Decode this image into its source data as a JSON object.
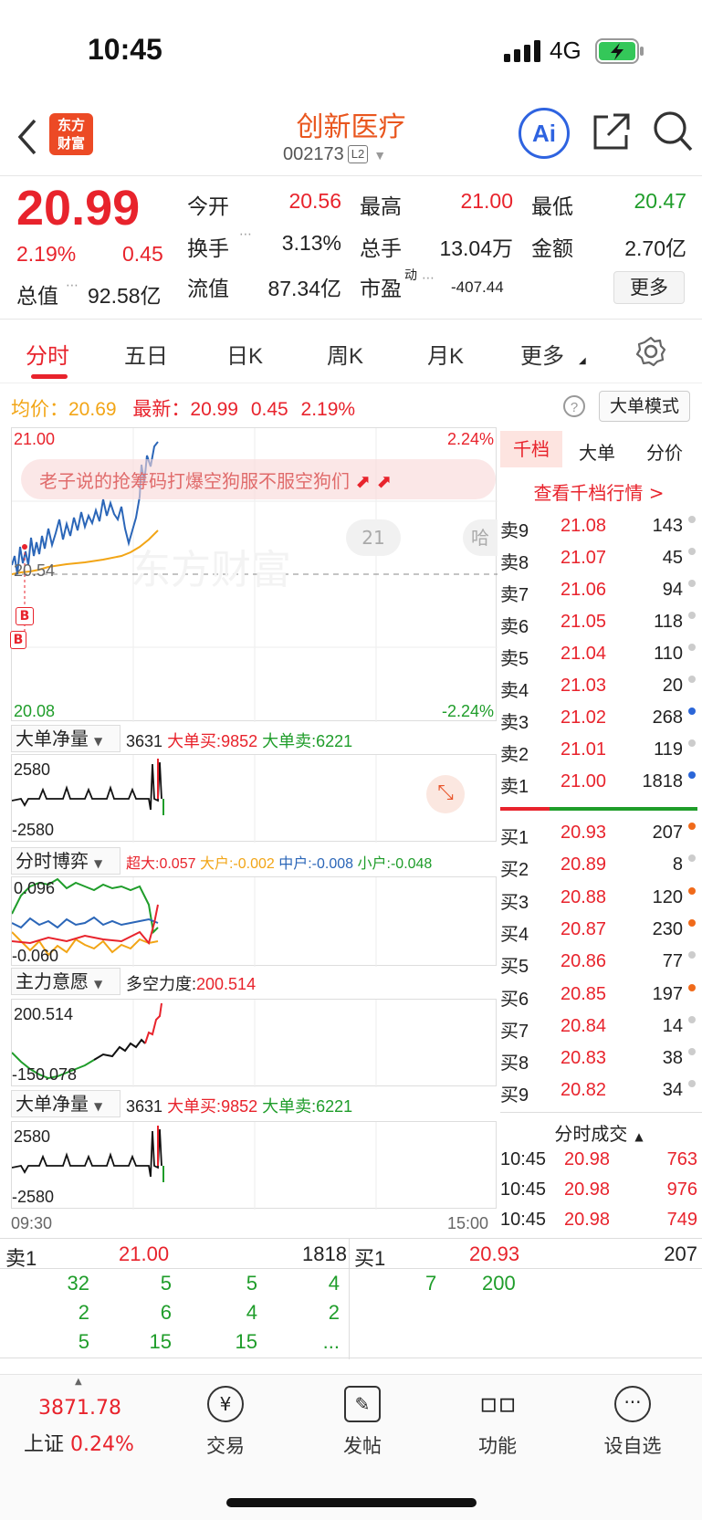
{
  "status_bar": {
    "time": "10:45",
    "network": "4G"
  },
  "header": {
    "logo_text_1": "东方",
    "logo_text_2": "财富",
    "stock_name": "创新医疗",
    "stock_code": "002173",
    "level_badge": "L2",
    "ai_label": "Ai"
  },
  "quote": {
    "price": "20.99",
    "change_pct": "2.19%",
    "change": "0.45",
    "open_label": "今开",
    "open": "20.56",
    "high_label": "最高",
    "high": "21.00",
    "low_label": "最低",
    "low": "20.47",
    "turnover_label": "换手",
    "turnover": "3.13%",
    "volume_label": "总手",
    "volume": "13.04万",
    "amount_label": "金额",
    "amount": "2.70亿",
    "mktcap_label": "总值",
    "mktcap": "92.58亿",
    "float_label": "流值",
    "float_cap": "87.34亿",
    "pe_label": "市盈",
    "pe_sup": "动",
    "pe": "-407.44",
    "more_button": "更多"
  },
  "tabs": [
    "分时",
    "五日",
    "日K",
    "周K",
    "月K",
    "更多"
  ],
  "chart_info": {
    "avg_label": "均价：",
    "avg": "20.69",
    "latest_label": "最新：",
    "latest": "20.99",
    "change": "0.45",
    "change_pct": "2.19%",
    "mode_button": "大单模式"
  },
  "main_chart": {
    "y_top": "21.00",
    "y_mid": "20.54",
    "y_bottom": "20.08",
    "pct_top": "2.24%",
    "pct_bottom": "-2.24%",
    "danmaku": "老子说的抢筹码打爆空狗服不服空狗们",
    "bubble_count": "21",
    "bubble_2": "哈",
    "watermark": "东方财富",
    "marker_b": "B",
    "time_start": "09:30",
    "time_end": "15:00"
  },
  "indicator_1": {
    "selector": "大单净量",
    "value": "3631",
    "buy_label": "大单买:9852",
    "sell_label": "大单卖:6221",
    "y_top": "2580",
    "y_bottom": "-2580"
  },
  "indicator_2": {
    "selector": "分时博弈",
    "super": "超大:0.057",
    "big": "大户:-0.002",
    "mid": "中户:-0.008",
    "small": "小户:-0.048",
    "y_top": "0.096",
    "y_bottom": "-0.060"
  },
  "indicator_3": {
    "selector": "主力意愿",
    "power_label": "多空力度:",
    "power": "200.514",
    "y_top": "200.514",
    "y_bottom": "-150.078"
  },
  "indicator_4": {
    "selector": "大单净量",
    "value": "3631",
    "buy_label": "大单买:9852",
    "sell_label": "大单卖:6221",
    "y_top": "2580",
    "y_bottom": "-2580"
  },
  "orderbook": {
    "tabs": [
      "千档",
      "大单",
      "分价"
    ],
    "view_link": "查看千档行情 >",
    "asks": [
      {
        "label": "卖9",
        "price": "21.08",
        "vol": "143",
        "dot": "#cccccc"
      },
      {
        "label": "卖8",
        "price": "21.07",
        "vol": "45",
        "dot": "#cccccc"
      },
      {
        "label": "卖7",
        "price": "21.06",
        "vol": "94",
        "dot": "#cccccc"
      },
      {
        "label": "卖6",
        "price": "21.05",
        "vol": "118",
        "dot": "#cccccc"
      },
      {
        "label": "卖5",
        "price": "21.04",
        "vol": "110",
        "dot": "#cccccc"
      },
      {
        "label": "卖4",
        "price": "21.03",
        "vol": "20",
        "dot": "#cccccc"
      },
      {
        "label": "卖3",
        "price": "21.02",
        "vol": "268",
        "dot": "#2b66d8"
      },
      {
        "label": "卖2",
        "price": "21.01",
        "vol": "119",
        "dot": "#cccccc"
      },
      {
        "label": "卖1",
        "price": "21.00",
        "vol": "1818",
        "dot": "#2b66d8"
      }
    ],
    "bids": [
      {
        "label": "买1",
        "price": "20.93",
        "vol": "207",
        "dot": "#f06a1a"
      },
      {
        "label": "买2",
        "price": "20.89",
        "vol": "8",
        "dot": "#cccccc"
      },
      {
        "label": "买3",
        "price": "20.88",
        "vol": "120",
        "dot": "#f06a1a"
      },
      {
        "label": "买4",
        "price": "20.87",
        "vol": "230",
        "dot": "#f06a1a"
      },
      {
        "label": "买5",
        "price": "20.86",
        "vol": "77",
        "dot": "#cccccc"
      },
      {
        "label": "买6",
        "price": "20.85",
        "vol": "197",
        "dot": "#f06a1a"
      },
      {
        "label": "买7",
        "price": "20.84",
        "vol": "14",
        "dot": "#cccccc"
      },
      {
        "label": "买8",
        "price": "20.83",
        "vol": "38",
        "dot": "#cccccc"
      },
      {
        "label": "买9",
        "price": "20.82",
        "vol": "34",
        "dot": "#cccccc"
      }
    ],
    "ticks_title": "分时成交",
    "ticks": [
      {
        "time": "10:45",
        "price": "20.98",
        "vol": "763"
      },
      {
        "time": "10:45",
        "price": "20.98",
        "vol": "976"
      },
      {
        "time": "10:45",
        "price": "20.98",
        "vol": "749"
      }
    ]
  },
  "bottom_book": {
    "sell_label": "卖1",
    "sell_price": "21.00",
    "sell_vol": "1818",
    "buy_label": "买1",
    "buy_price": "20.93",
    "buy_vol": "207",
    "sell_queue": [
      [
        "32",
        "5",
        "5",
        "4"
      ],
      [
        "2",
        "6",
        "4",
        "2"
      ],
      [
        "5",
        "15",
        "15",
        "..."
      ]
    ],
    "buy_queue": [
      "7",
      "200"
    ]
  },
  "footer": {
    "index_value": "3871.78",
    "index_name": "上证",
    "index_pct": "0.24%",
    "items": [
      "交易",
      "发帖",
      "功能",
      "设自选"
    ]
  },
  "colors": {
    "up": "#e8232c",
    "down": "#1f9d2a",
    "brand": "#ec4a25",
    "accent_blue": "#2e63e0"
  }
}
